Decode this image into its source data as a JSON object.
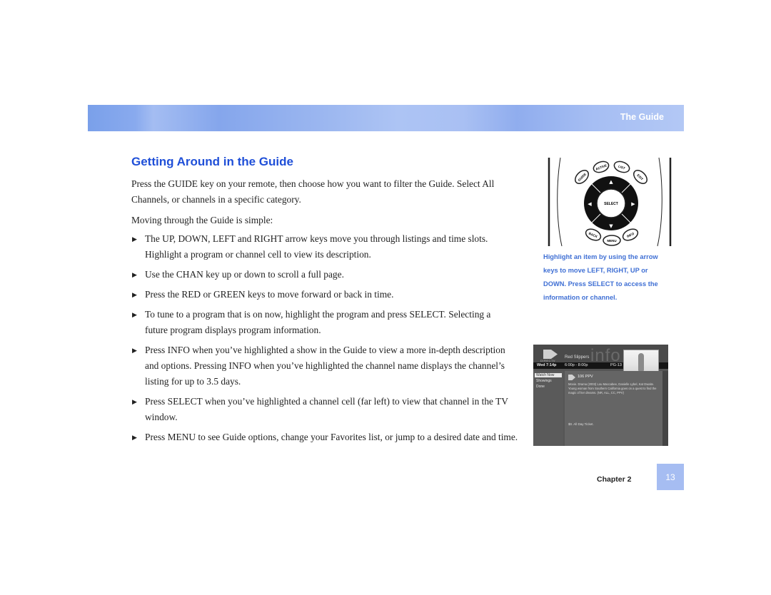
{
  "header": {
    "section_title": "The Guide",
    "banner_color": "#8fb0ef"
  },
  "main": {
    "heading": "Getting Around in the Guide",
    "heading_color": "#1f4fd8",
    "intro": "Press the GUIDE key on your remote, then choose how you want to filter the Guide. Select All Channels, or channels in a specific category.",
    "lead_in": "Moving through the Guide is simple:",
    "bullet_icon": "triangle-right-icon",
    "bullets": [
      {
        "text": "The UP, DOWN, LEFT and RIGHT arrow keys move you through listings and time slots. Highlight a program or channel cell to view its description."
      },
      {
        "text": "Use the CHAN key up or down to scroll a full page."
      },
      {
        "text": "Press the RED or GREEN keys to move forward or back in time."
      },
      {
        "text": "To tune to a program that is on now, highlight the program and press SELECT. Selecting a future program displays program information."
      },
      {
        "text": "Press INFO when you’ve highlighted a show in the Guide to view a more in-depth description and options. Pressing INFO when you’ve highlighted the channel name displays the channel’s listing for up to 3.5 days."
      },
      {
        "text": "Press SELECT when you’ve highlighted a channel cell (far left) to view that channel in the TV window."
      },
      {
        "text": "Press MENU to see Guide options, change your Favorites list, or jump to a desired date and time."
      }
    ]
  },
  "remote": {
    "buttons": {
      "active": "ACTIVE",
      "list": "LIST",
      "guide": "GUIDE",
      "exit": "EXIT",
      "select": "SELECT",
      "back": "BACK",
      "menu": "MENU",
      "info": "INFO"
    },
    "arrows": {
      "up": "▲",
      "down": "▼",
      "left": "◀",
      "right": "▶"
    }
  },
  "sidebar": {
    "caption": "Highlight an item by using the arrow keys to move LEFT, RIGHT, UP or DOWN. Press SELECT to access the information or channel.",
    "caption_color": "#3f6fd4"
  },
  "tv_screen": {
    "brand": "DIRECTV",
    "watermark": "info",
    "program_title": "Red Slippers",
    "current_time": "Wed 7:14p",
    "time_slot": "6:00p - 8:00p",
    "rating": "PG-13",
    "menu_items": [
      "Watch Now",
      "Showings",
      "Done"
    ],
    "channel": "106 PPV",
    "description": "Movie. Drama (2003) Lou Maccabee, Danielle Lybel, Kat Dwaite. Young woman from Southern California goes on a quest to find the magic of her dreams. (NR, ALL, CC, PPV)",
    "footer": "$0. All Day Ticket."
  },
  "footer": {
    "chapter": "Chapter 2",
    "page_number": "13",
    "page_box_color": "#a6bdf2"
  }
}
